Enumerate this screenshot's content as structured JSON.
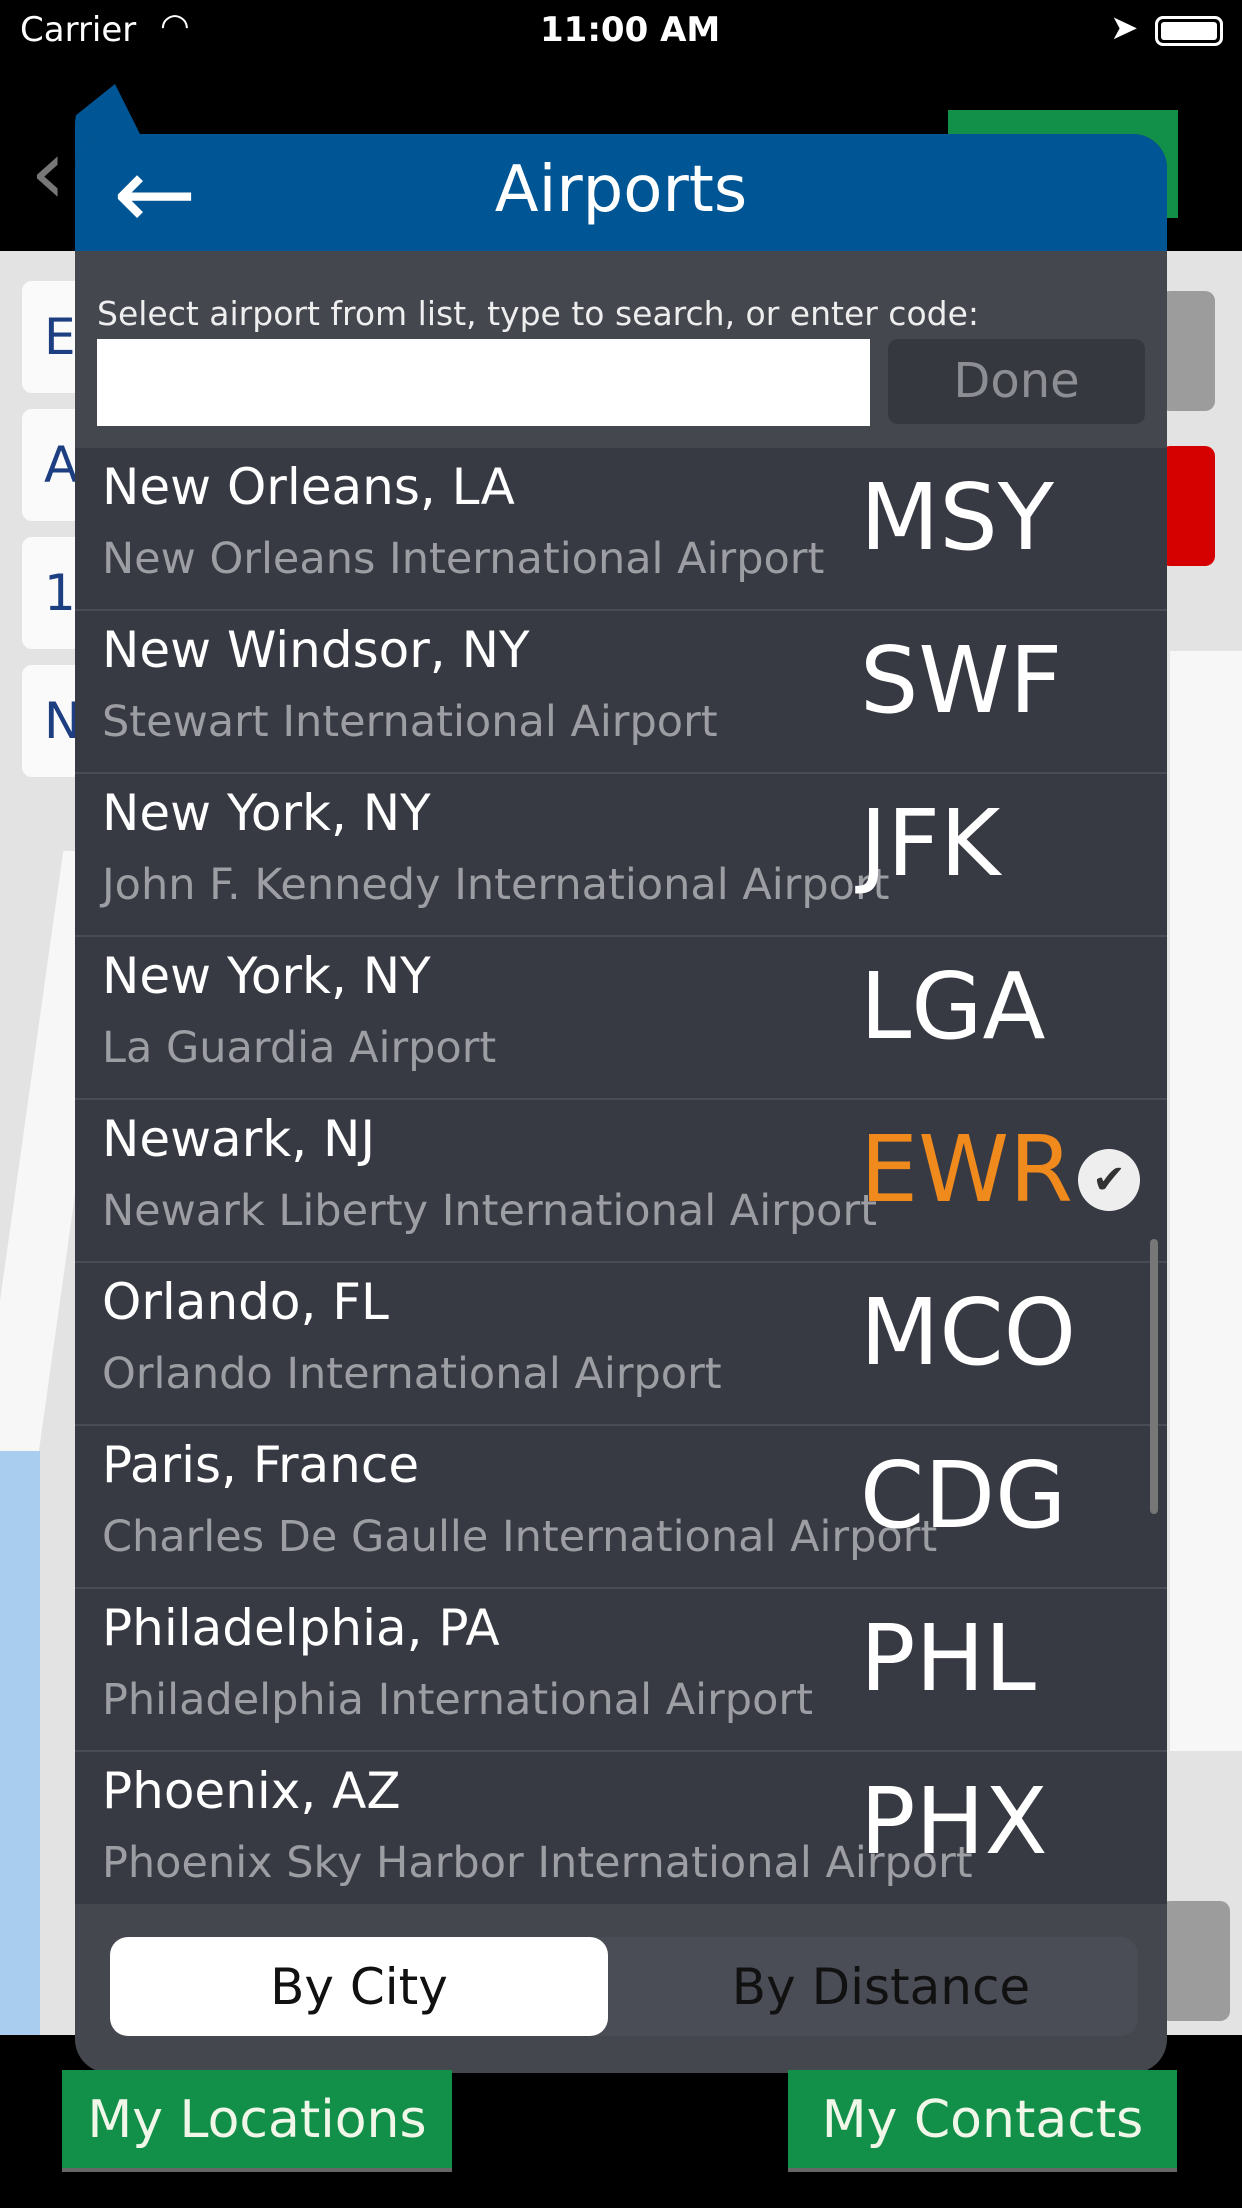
{
  "status_bar": {
    "carrier": "Carrier",
    "time": "11:00 AM"
  },
  "modal": {
    "title": "Airports",
    "instruction": "Select airport from list, type to search, or enter code:",
    "search_value": "",
    "done_label": "Done",
    "airports": [
      {
        "city": "New Orleans, LA",
        "name": "New Orleans International Airport",
        "code": "MSY"
      },
      {
        "city": "New Windsor, NY",
        "name": "Stewart International Airport",
        "code": "SWF"
      },
      {
        "city": "New York, NY",
        "name": "John F. Kennedy International Airport",
        "code": "JFK"
      },
      {
        "city": "New York, NY",
        "name": "La Guardia Airport",
        "code": "LGA"
      },
      {
        "city": "Newark, NJ",
        "name": "Newark Liberty International Airport",
        "code": "EWR",
        "selected": true
      },
      {
        "city": "Orlando, FL",
        "name": "Orlando International Airport",
        "code": "MCO"
      },
      {
        "city": "Paris, France",
        "name": "Charles De Gaulle International Airport",
        "code": "CDG"
      },
      {
        "city": "Philadelphia, PA",
        "name": "Philadelphia International Airport",
        "code": "PHL"
      },
      {
        "city": "Phoenix, AZ",
        "name": "Phoenix Sky Harbor International Airport",
        "code": "PHX"
      }
    ],
    "sort": {
      "options": [
        "By City",
        "By Distance"
      ],
      "selected": "By City"
    }
  },
  "background": {
    "fields": [
      "E",
      "A",
      "1",
      "N"
    ],
    "my_locations": "My Locations",
    "my_contacts": "My Contacts"
  },
  "colors": {
    "header": "#005594",
    "selected_code": "#f08a1c",
    "green": "#12904a",
    "panel": "#383a43"
  }
}
